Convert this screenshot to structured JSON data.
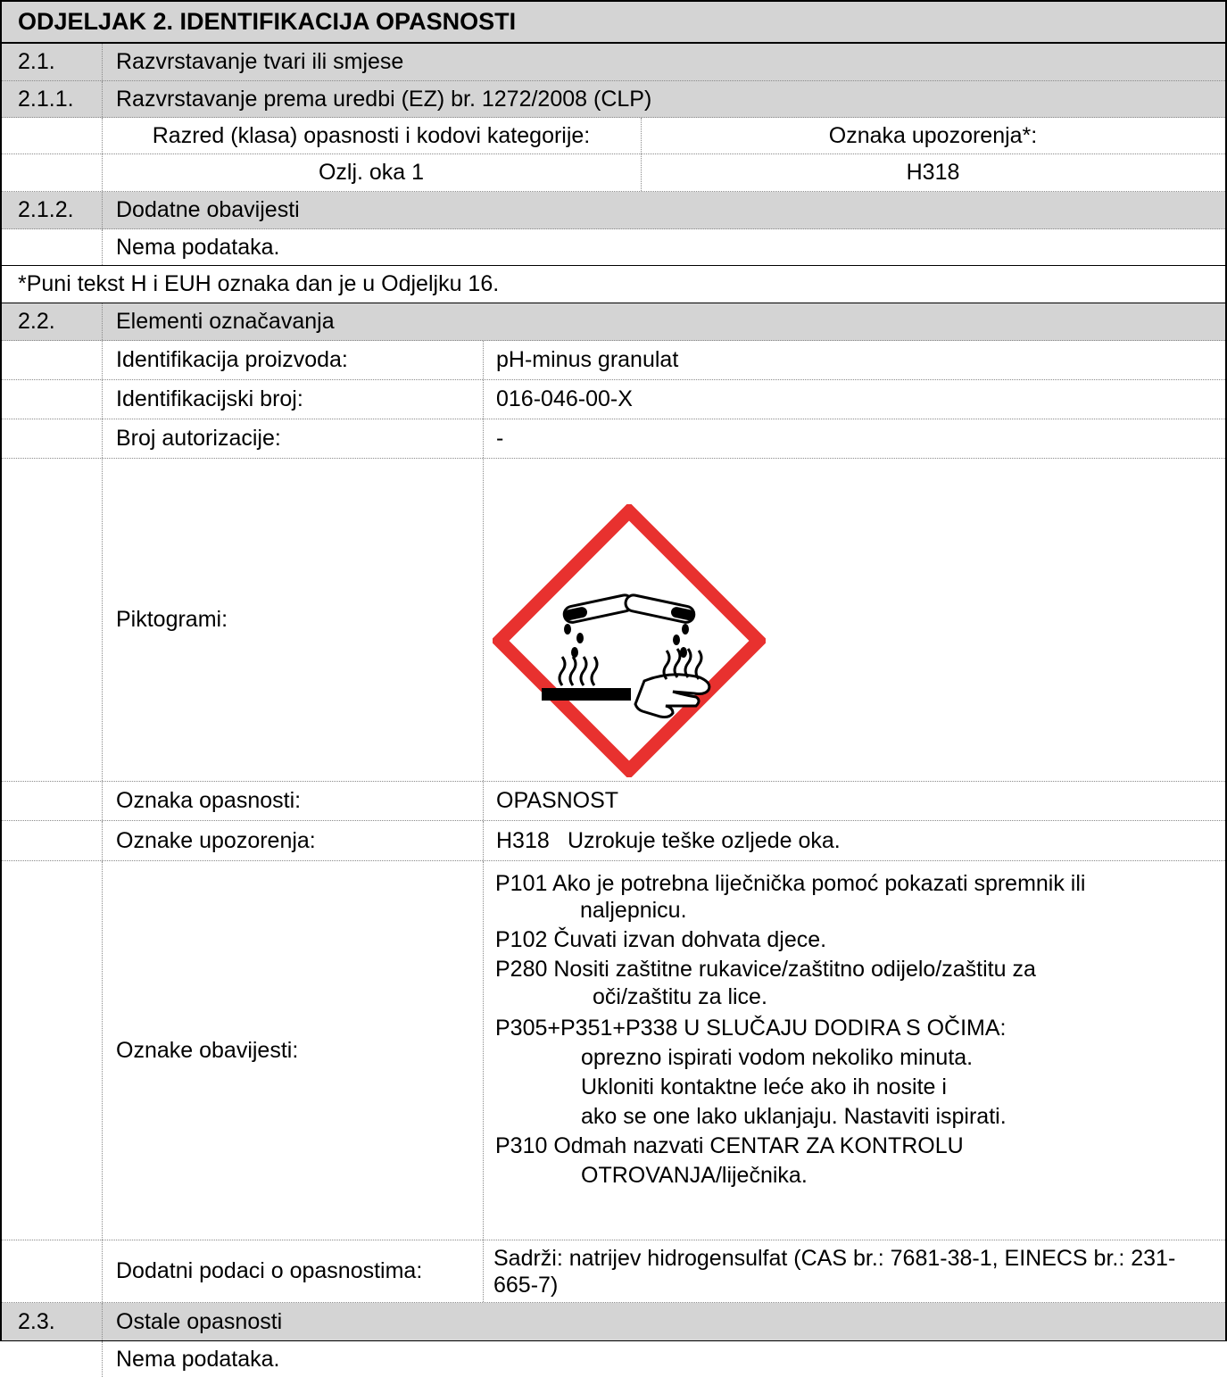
{
  "section_title": "ODJELJAK 2. IDENTIFIKACIJA OPASNOSTI",
  "r21": {
    "num": "2.1.",
    "label": "Razvrstavanje tvari ili smjese"
  },
  "r211": {
    "num": "2.1.1.",
    "label": "Razvrstavanje prema uredbi (EZ) br. 1272/2008 (CLP)"
  },
  "classification": {
    "col1_header": "Razred (klasa) opasnosti i kodovi kategorije:",
    "col2_header": "Oznaka upozorenja*:",
    "col1_value": "Ozlj. oka 1",
    "col2_value": "H318"
  },
  "r212": {
    "num": "2.1.2.",
    "label": "Dodatne obavijesti",
    "text": "Nema podataka."
  },
  "footnote": "*Puni tekst H i EUH oznaka dan je u Odjeljku 16.",
  "r22": {
    "num": "2.2.",
    "label": "Elementi označavanja"
  },
  "labels": {
    "product_id_label": "Identifikacija proizvoda:",
    "product_id_value": "pH-minus granulat",
    "id_number_label": "Identifikacijski broj:",
    "id_number_value": "016-046-00-X",
    "auth_label": "Broj autorizacije:",
    "auth_value": "-",
    "pictograms_label": "Piktogrami:",
    "signal_label": "Oznaka opasnosti:",
    "signal_value": "OPASNOST",
    "hazard_label": "Oznake upozorenja:",
    "hazard_code": "H318",
    "hazard_text": "Uzrokuje teške ozljede oka.",
    "precaution_label": "Oznake obavijesti:",
    "additional_label": "Dodatni podaci o opasnostima:",
    "additional_value": "Sadrži: natrijev hidrogensulfat (CAS br.: 7681-38-1, EINECS br.: 231-665-7)"
  },
  "precautions": [
    "P101  Ako je potrebna liječnička pomoć pokazati spremnik ili",
    "naljepnicu.",
    "P102  Čuvati izvan dohvata djece.",
    "P280  Nositi zaštitne rukavice/zaštitno odijelo/zaštitu za",
    "oči/zaštitu za lice.",
    "P305+P351+P338 U SLUČAJU DODIRA S OČIMA:",
    "oprezno ispirati vodom nekoliko minuta.",
    "Ukloniti kontaktne leće ako ih nosite i",
    "ako se one lako uklanjaju. Nastaviti ispirati.",
    "P310  Odmah nazvati CENTAR ZA KONTROLU",
    "OTROVANJA/liječnika."
  ],
  "r23": {
    "num": "2.3.",
    "label": "Ostale opasnosti",
    "text": "Nema podataka."
  },
  "colors": {
    "header_gray": "#d4d4d4",
    "pictogram_red": "#e8312f"
  },
  "icons": {
    "pictogram": "ghs05-corrosion-icon"
  }
}
